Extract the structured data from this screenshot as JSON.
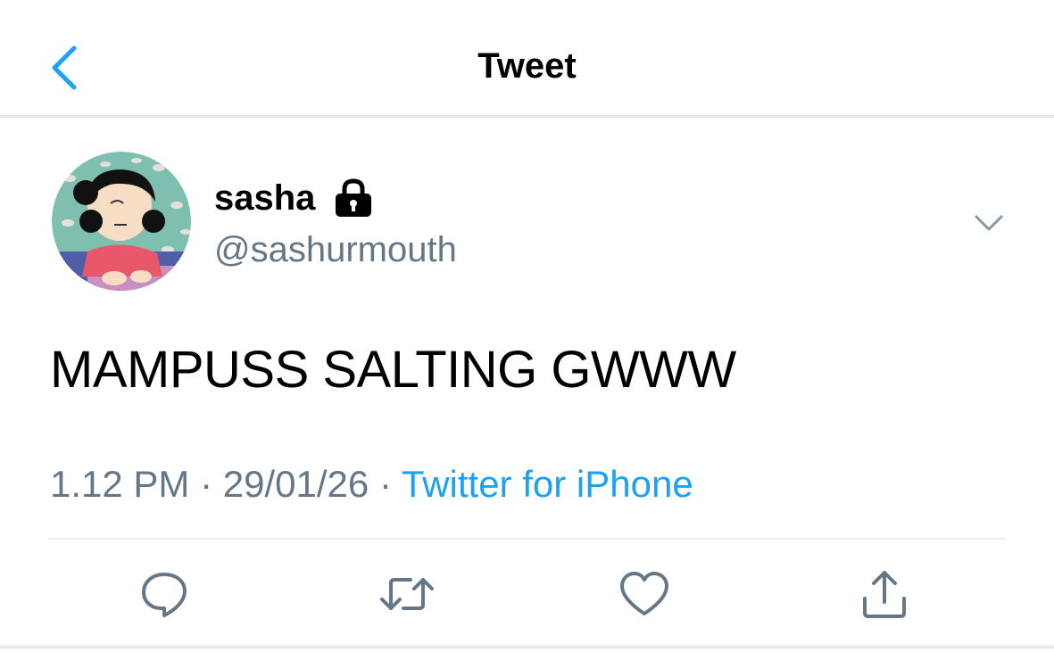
{
  "header": {
    "title": "Tweet",
    "back_icon": "chevron-left-icon"
  },
  "colors": {
    "accent": "#1da1f2",
    "secondary_text": "#657786",
    "divider": "#e1e8ed"
  },
  "tweet": {
    "author": {
      "display_name": "sasha",
      "handle": "@sashurmouth",
      "protected": true,
      "avatar_icon": "avatar-cartoon-girl"
    },
    "text": "MAMPUSS SALTING GWWW",
    "time": "1.12 PM",
    "separator": "·",
    "date": "29/01/26",
    "source": "Twitter for iPhone"
  },
  "actions": [
    {
      "name": "reply",
      "icon": "reply-icon"
    },
    {
      "name": "retweet",
      "icon": "retweet-icon"
    },
    {
      "name": "like",
      "icon": "heart-icon"
    },
    {
      "name": "share",
      "icon": "share-icon"
    }
  ]
}
